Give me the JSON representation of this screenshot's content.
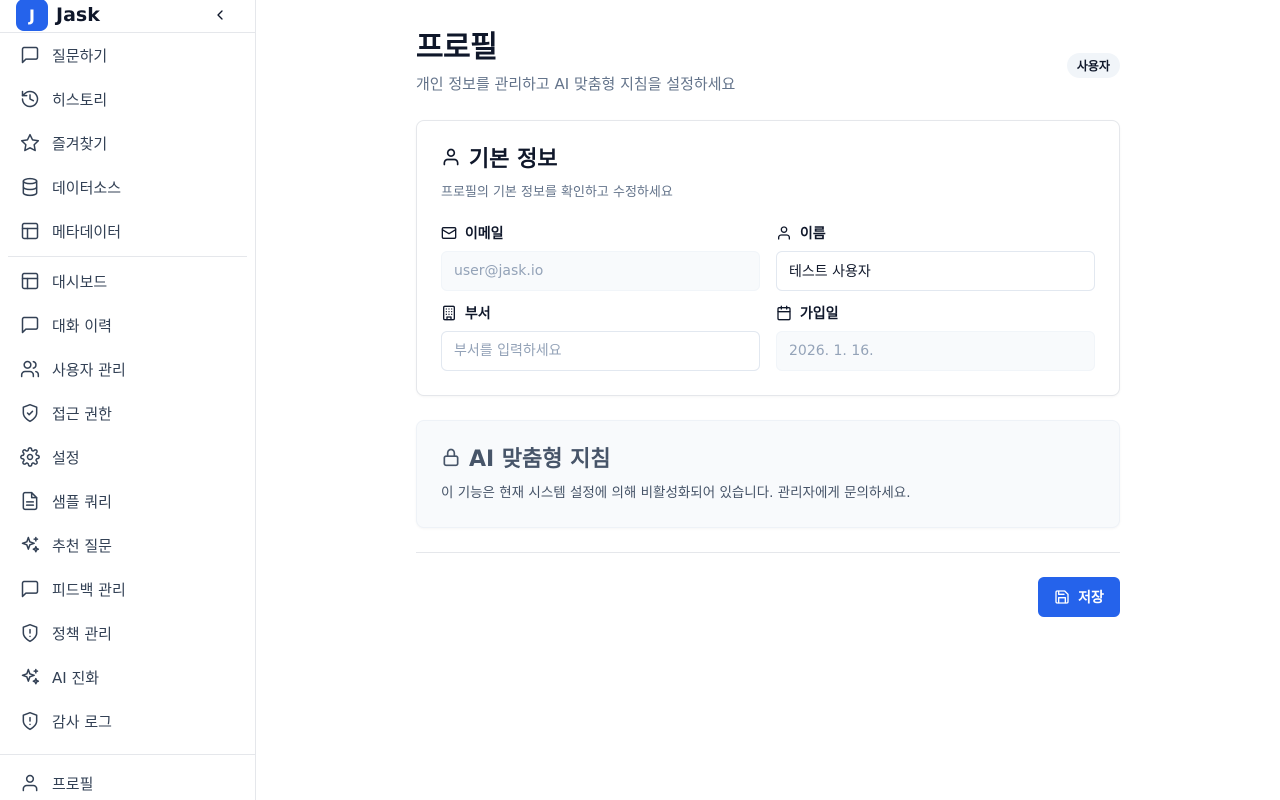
{
  "brand": {
    "logo_letter": "J",
    "name": "Jask"
  },
  "sidebar": {
    "group1": [
      {
        "label": "질문하기",
        "icon": "message-square-icon"
      },
      {
        "label": "히스토리",
        "icon": "history-icon"
      },
      {
        "label": "즐겨찾기",
        "icon": "star-icon"
      },
      {
        "label": "데이터소스",
        "icon": "database-icon"
      },
      {
        "label": "메타데이터",
        "icon": "layout-icon"
      }
    ],
    "group2": [
      {
        "label": "대시보드",
        "icon": "layout-icon"
      },
      {
        "label": "대화 이력",
        "icon": "message-square-icon"
      },
      {
        "label": "사용자 관리",
        "icon": "users-icon"
      },
      {
        "label": "접근 권한",
        "icon": "shield-check-icon"
      },
      {
        "label": "설정",
        "icon": "gear-icon"
      },
      {
        "label": "샘플 쿼리",
        "icon": "file-text-icon"
      },
      {
        "label": "추천 질문",
        "icon": "sparkles-icon"
      },
      {
        "label": "피드백 관리",
        "icon": "message-square-icon"
      },
      {
        "label": "정책 관리",
        "icon": "shield-alert-icon"
      },
      {
        "label": "AI 진화",
        "icon": "sparkles-icon"
      },
      {
        "label": "감사 로그",
        "icon": "shield-alert-icon"
      }
    ],
    "bottom": {
      "label": "프로필",
      "icon": "user-icon"
    }
  },
  "page": {
    "title": "프로필",
    "subtitle": "개인 정보를 관리하고 AI 맞춤형 지침을 설정하세요",
    "role_badge": "사용자"
  },
  "basic_info": {
    "title": "기본 정보",
    "description": "프로필의 기본 정보를 확인하고 수정하세요",
    "fields": {
      "email": {
        "label": "이메일",
        "value": "user@jask.io"
      },
      "name": {
        "label": "이름",
        "value": "테스트 사용자"
      },
      "department": {
        "label": "부서",
        "placeholder": "부서를 입력하세요"
      },
      "joined": {
        "label": "가입일",
        "value": "2026. 1. 16."
      }
    }
  },
  "ai_guidance": {
    "title": "AI 맞춤형 지침",
    "description": "이 기능은 현재 시스템 설정에 의해 비활성화되어 있습니다. 관리자에게 문의하세요."
  },
  "actions": {
    "save_label": "저장"
  },
  "colors": {
    "accent": "#2563eb",
    "muted_text": "#64748b",
    "border": "#e5e7eb"
  }
}
